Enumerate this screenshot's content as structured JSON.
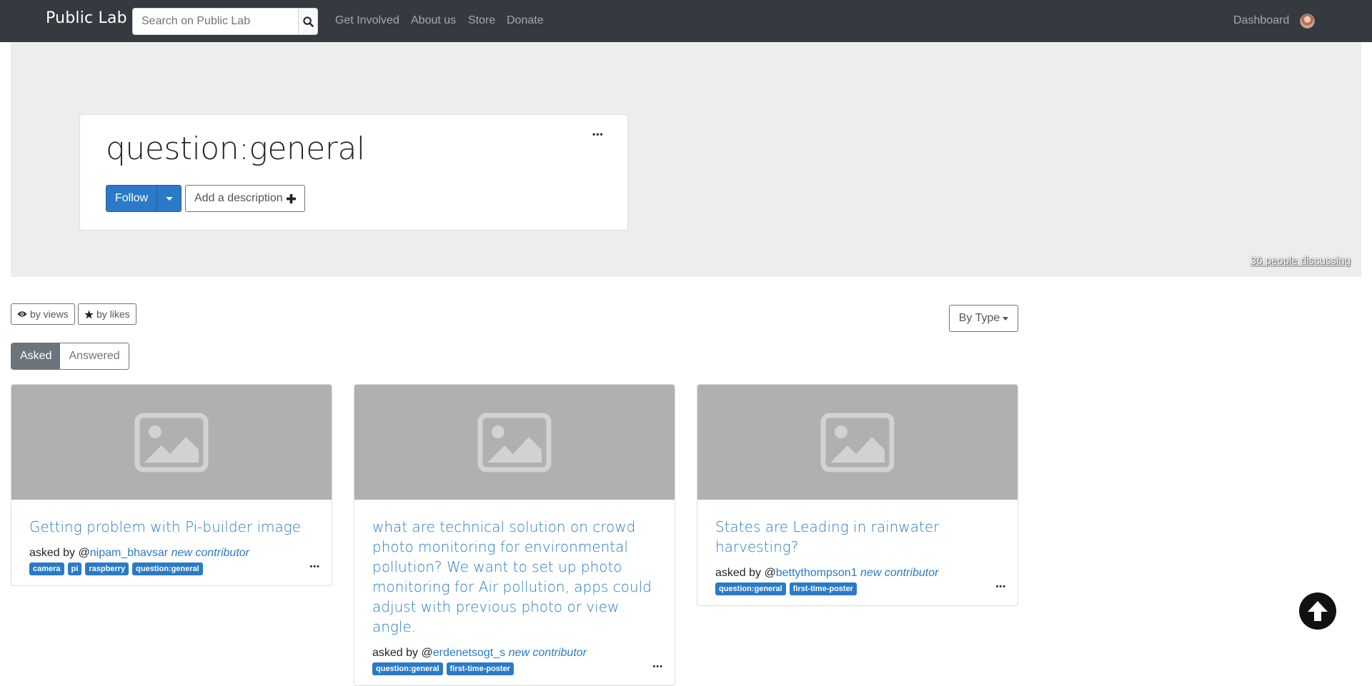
{
  "navbar": {
    "brand": "Public Lab",
    "search_placeholder": "Search on Public Lab",
    "links": [
      "Get Involved",
      "About us",
      "Store",
      "Donate"
    ],
    "dashboard": "Dashboard"
  },
  "header": {
    "title": "question:general",
    "follow_label": "Follow",
    "add_description_label": "Add a description",
    "discussing": "36 people discussing",
    "menu_icon": "ellipsis-icon"
  },
  "sort": {
    "by_views": "by views",
    "by_likes": "by likes",
    "by_type": "By Type",
    "asked": "Asked",
    "answered": "Answered"
  },
  "questions": [
    {
      "title": "Getting problem with Pi-builder image",
      "asked_by": "asked by @",
      "author": "nipam_bhavsar",
      "badge": "new contributor",
      "tags": [
        "camera",
        "pi",
        "raspberry",
        "question:general"
      ]
    },
    {
      "title": "what are technical solution on crowd photo monitoring for environmental pollution? We want to set up photo monitoring for Air pollution, apps could adjust with previous photo or view angle.",
      "asked_by": "asked by @",
      "author": "erdenetsogt_s",
      "badge": "new contributor",
      "tags": [
        "question:general",
        "first-time-poster"
      ]
    },
    {
      "title": "States are Leading in rainwater harvesting?",
      "asked_by": "asked by @",
      "author": "bettythompson1",
      "badge": "new contributor",
      "tags": [
        "question:general",
        "first-time-poster"
      ]
    }
  ],
  "colors": {
    "navbar": "#343a40",
    "accent": "#2a7ac8",
    "jumbotron": "#ededed",
    "placeholder": "#b0b0b0"
  }
}
